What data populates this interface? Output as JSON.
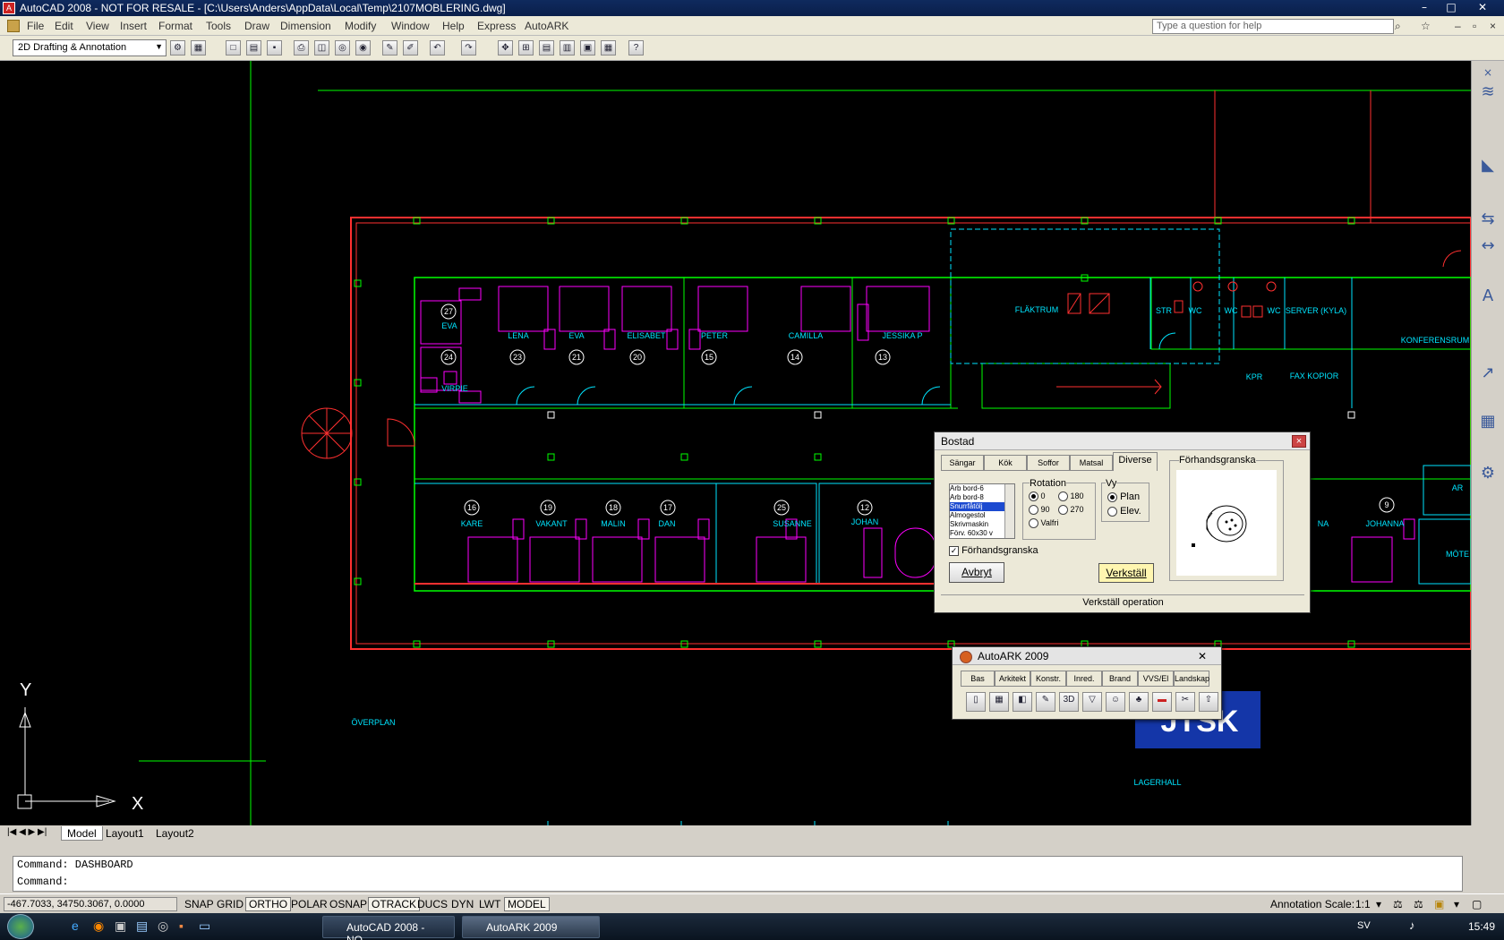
{
  "window": {
    "title": "AutoCAD 2008 - NOT FOR RESALE - [C:\\Users\\Anders\\AppData\\Local\\Temp\\2107MOBLERING.dwg]",
    "minimize": "–",
    "maximize": "□",
    "close": "✕"
  },
  "menu": {
    "items": [
      "File",
      "Edit",
      "View",
      "Insert",
      "Format",
      "Tools",
      "Draw",
      "Dimension",
      "Modify",
      "Window",
      "Help",
      "Express",
      "AutoARK"
    ],
    "help_placeholder": "Type a question for help"
  },
  "toolbar": {
    "workspace": "2D Drafting & Annotation"
  },
  "drawing": {
    "rooms_top": [
      "EVA",
      "LENA",
      "EVA",
      "ELISABET",
      "PETER",
      "CAMILLA",
      "JESSIKA P",
      "VIRPIE"
    ],
    "numbers_top": [
      "27",
      "24",
      "23",
      "21",
      "20",
      "15",
      "14",
      "13"
    ],
    "rooms_bottom": [
      "KARE",
      "VAKANT",
      "MALIN",
      "DAN",
      "SUSANNE",
      "JOHAN",
      "JOHANNA",
      "NA"
    ],
    "numbers_bottom": [
      "16",
      "19",
      "18",
      "17",
      "25",
      "12",
      "9"
    ],
    "labels": {
      "flaktrum": "FLÄKTRUM",
      "wc1": "WC",
      "wc2": "WC",
      "wc3": "WC",
      "str": "STR",
      "server": "SERVER (KYLA)",
      "fax": "FAX KOPIOR",
      "kpr": "KPR",
      "konf": "KONFERENSRUM",
      "overplan": "ÖVERPLAN",
      "lagerhall": "LAGERHALL",
      "mote": "MÖTE",
      "ar": "AR",
      "logo": "JTSK"
    },
    "axis": {
      "y": "Y",
      "x": "X"
    }
  },
  "tabs": [
    "Model",
    "Layout1",
    "Layout2"
  ],
  "command": {
    "line1": "Command: DASHBOARD",
    "line2": "Command:"
  },
  "status": {
    "coords": "-467.7033, 34750.3067, 0.0000",
    "buttons": [
      "SNAP",
      "GRID",
      "ORTHO",
      "POLAR",
      "OSNAP",
      "OTRACK",
      "DUCS",
      "DYN",
      "LWT",
      "MODEL"
    ],
    "annotation_scale_label": "Annotation Scale:",
    "annotation_scale": "1:1"
  },
  "taskbar": {
    "tasks": [
      "AutoCAD 2008 - NO...",
      "AutoARK 2009"
    ],
    "lang": "SV",
    "time": "15:49"
  },
  "bostad": {
    "title": "Bostad",
    "tabs": [
      "Sängar",
      "Kök",
      "Soffor",
      "Matsal",
      "Diverse"
    ],
    "list": [
      "Arb bord-6",
      "Arb bord-8",
      "Snurrfåtölj",
      "Almogestol",
      "Skrivmaskin",
      "Förv. 60x30 v"
    ],
    "rotation_label": "Rotation",
    "rot": [
      "0",
      "180",
      "90",
      "270",
      "Valfri"
    ],
    "vy_label": "Vy",
    "vy": [
      "Plan",
      "Elev."
    ],
    "preview_check": "Förhandsgranska",
    "preview_title": "Förhandsgranska",
    "cancel": "Avbryt",
    "apply": "Verkställ",
    "status": "Verkställ operation"
  },
  "autoark": {
    "title": "AutoARK 2009",
    "tabs": [
      "Bas",
      "Arkitekt",
      "Konstr.",
      "Inred.",
      "Brand",
      "VVS/El",
      "Landskap"
    ],
    "tool3d": "3D"
  },
  "colors": {
    "red": "#ff3030",
    "green": "#00ff00",
    "cyan": "#00e5ff",
    "magenta": "#ff00ff"
  }
}
